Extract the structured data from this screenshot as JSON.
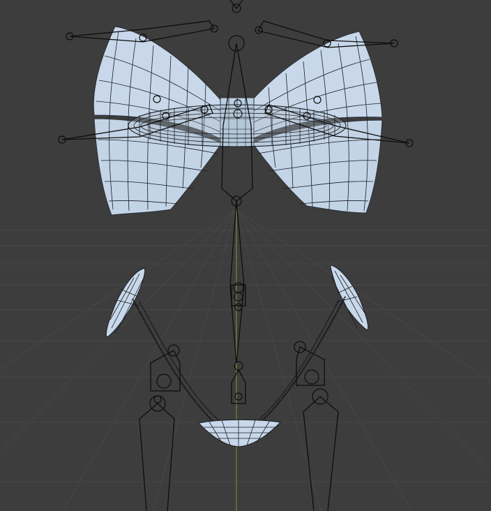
{
  "viewport": {
    "background": "#3d3d3d",
    "grid_color": "#464646",
    "grid_axis_y_color": "#6f8a2a",
    "mesh_fill": "#c9d9ea",
    "mesh_wire": "#1a1d22",
    "bone_color": "#0d0d0d"
  },
  "objects": [
    {
      "name": "bow-mesh",
      "kind": "mesh"
    },
    {
      "name": "bow-knot-band",
      "kind": "mesh"
    },
    {
      "name": "left-ear-clip",
      "kind": "mesh"
    },
    {
      "name": "right-ear-clip",
      "kind": "mesh"
    },
    {
      "name": "chain-cups",
      "kind": "mesh"
    },
    {
      "name": "armature",
      "kind": "armature"
    }
  ]
}
